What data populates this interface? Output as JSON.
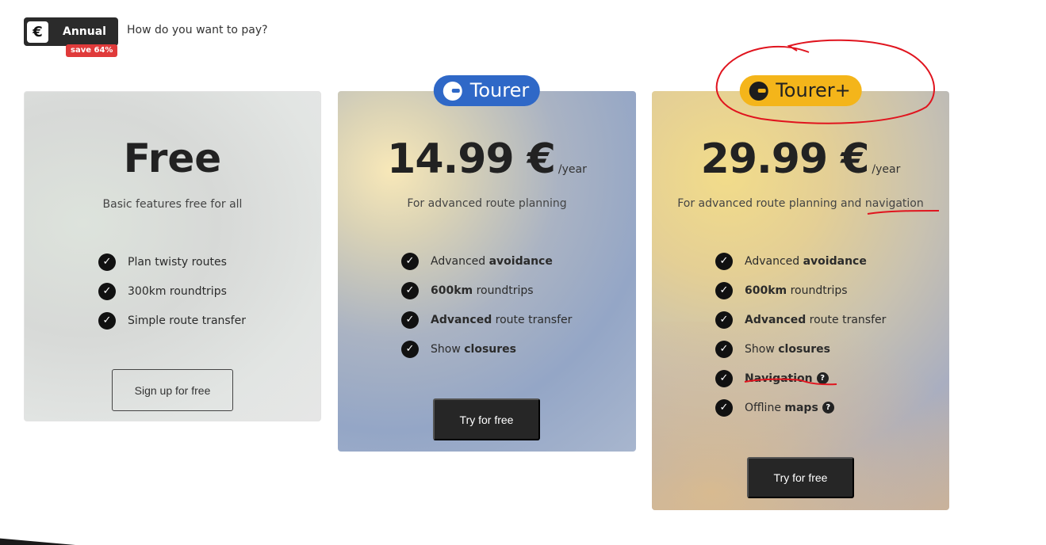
{
  "billing": {
    "currency_symbol": "€",
    "toggle_label": "Annual",
    "save_badge": "save 64%",
    "question": "How do you want to pay?"
  },
  "plans": {
    "free": {
      "title": "Free",
      "subtitle": "Basic features free for all",
      "features": [
        {
          "plain": "Plan twisty routes"
        },
        {
          "plain": "300km roundtrips"
        },
        {
          "plain": "Simple route transfer"
        }
      ],
      "button": "Sign up for free"
    },
    "tourer": {
      "badge": "Tourer",
      "price": "14.99 €",
      "period": "/year",
      "subtitle": "For advanced route planning",
      "features": [
        {
          "pre": "Advanced ",
          "bold": "avoidance",
          "post": ""
        },
        {
          "pre": "",
          "bold": "600km",
          "post": " roundtrips"
        },
        {
          "pre": "",
          "bold": "Advanced",
          "post": " route transfer"
        },
        {
          "pre": "Show ",
          "bold": "closures",
          "post": ""
        }
      ],
      "button": "Try for free"
    },
    "tourer_plus": {
      "badge": "Tourer+",
      "price": "29.99 €",
      "period": "/year",
      "subtitle": "For advanced route planning and navigation",
      "features": [
        {
          "pre": "Advanced ",
          "bold": "avoidance",
          "post": ""
        },
        {
          "pre": "",
          "bold": "600km",
          "post": " roundtrips"
        },
        {
          "pre": "",
          "bold": "Advanced",
          "post": " route transfer"
        },
        {
          "pre": "Show ",
          "bold": "closures",
          "post": ""
        },
        {
          "pre": "",
          "bold": "Navigation",
          "post": ""
        },
        {
          "pre": "Offline ",
          "bold": "maps",
          "post": ""
        }
      ],
      "button": "Try for free"
    }
  },
  "icons": {
    "check": "✓",
    "help": "?"
  },
  "colors": {
    "tourer_badge": "#2f68c7",
    "tourer_plus_badge": "#f4b51a",
    "save_badge": "#e03a3a",
    "annotation": "#e0141e"
  }
}
